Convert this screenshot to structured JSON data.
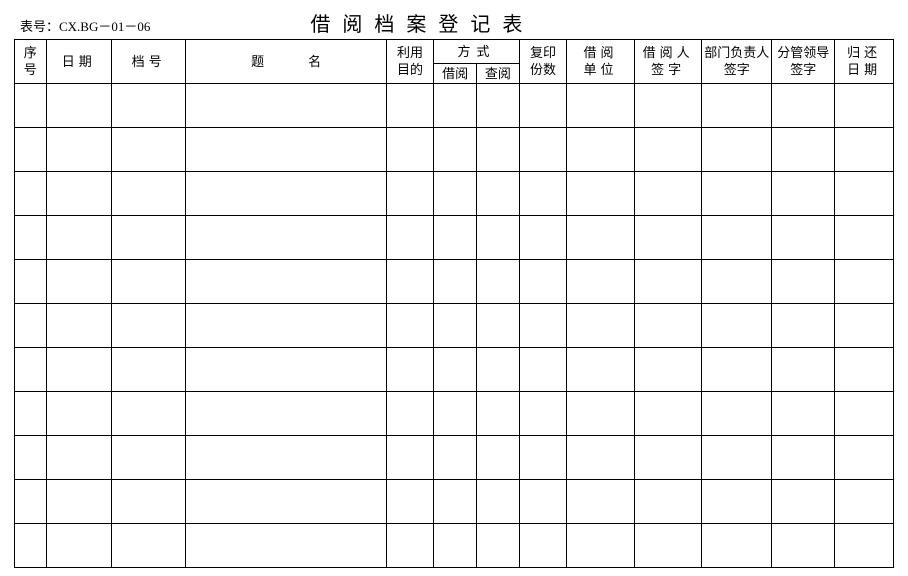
{
  "form_number_label": "表号：CX.BG－01－06",
  "title": "借阅档案登记表",
  "headers": {
    "seq": "序号",
    "date": "日期",
    "doc_no": "档号",
    "title_col": "题名",
    "purpose": "利用目的",
    "method": "方式",
    "method_borrow": "借阅",
    "method_read": "查阅",
    "copies": "复印份数",
    "unit": "借阅单位",
    "borrower_sign": "借阅人签字",
    "dept_sign": "部门负责人签字",
    "leader_sign": "分管领导签字",
    "return_date": "归还日期"
  },
  "row_count": 11
}
